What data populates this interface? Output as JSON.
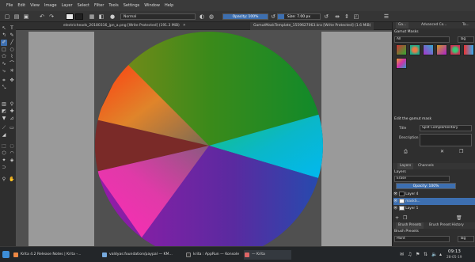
{
  "menu": {
    "items": [
      "File",
      "Edit",
      "View",
      "Image",
      "Layer",
      "Select",
      "Filter",
      "Tools",
      "Settings",
      "Window",
      "Help"
    ]
  },
  "toolbar": {
    "blend_mode": "Normal",
    "opacity_label": "Opacity: 100%",
    "opacity_value": 100,
    "size_label": "Size: 7.00 px",
    "size_fraction": 0.15,
    "fg_color": "#e8e8e8",
    "bg_color": "#202020",
    "undo_icon": "undo-icon",
    "redo_icon": "redo-icon"
  },
  "document_tabs": [
    {
      "label": "electricheads_20180316_jpn_a.png [Write Protected] (191.3 MiB)"
    },
    {
      "label": "GamutMaskTemplate_1559627063.kra [Write Protected] (1.6 MiB)"
    }
  ],
  "gamut_mask_panel": {
    "tab_label_1": "Ga...",
    "tab_label_2": "Advanced Co...",
    "tab_label_3": "Ta...",
    "title": "Gamut Masks",
    "filter_label": "All",
    "tag_label": "Tag",
    "edit_title": "Edit the gamut mask",
    "title_label": "Title",
    "title_value": "Split Complementary",
    "description_label": "Description",
    "description_value": ""
  },
  "layers_panel": {
    "tab_layers": "Layers",
    "tab_channels": "Channels",
    "title": "Layers",
    "blend": "Erase",
    "opacity_label": "Opacity: 100%",
    "opacity_value": 100,
    "layers": [
      {
        "name": "Layer 4"
      },
      {
        "name": "maskS..."
      },
      {
        "name": "Layer 1"
      }
    ]
  },
  "presets_panel": {
    "tab_presets": "Brush Presets",
    "tab_history": "Brush Preset History",
    "title": "Brush Presets",
    "filter": "Paint",
    "tag_label": "Tag"
  },
  "taskbar": {
    "items": [
      {
        "label": "Krita 4.2 Release Notes | Krita -..."
      },
      {
        "label": "valdyas:foundation/paypal — KM..."
      },
      {
        "label": "krita : AppRun — Konsole"
      },
      {
        "label": "— Krita"
      }
    ],
    "clock_time": "09:13",
    "clock_date": "28-05-19"
  },
  "colors": {
    "accent": "#3d6fb0",
    "panel": "#2f2f2f",
    "canvas_margin": "#9a9a9a"
  }
}
